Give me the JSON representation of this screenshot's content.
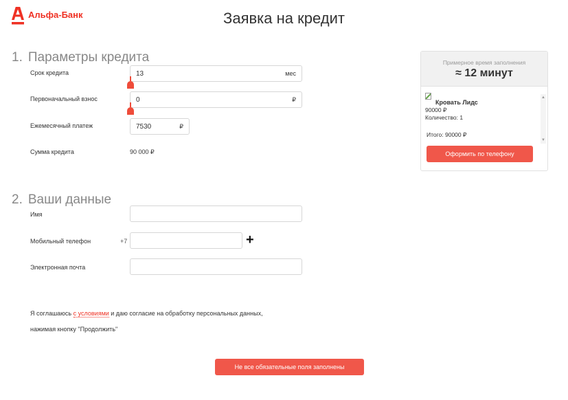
{
  "header": {
    "brand": "Альфа-Банк",
    "title": "Заявка на кредит"
  },
  "section1": {
    "number": "1.",
    "title": "Параметры кредита",
    "term": {
      "label": "Срок кредита",
      "value": "13",
      "unit": "мес"
    },
    "down_payment": {
      "label": "Первоначальный взнос",
      "value": "0",
      "unit": "₽"
    },
    "monthly": {
      "label": "Ежемесячный платеж",
      "value": "7530",
      "unit": "₽"
    },
    "sum": {
      "label": "Сумма кредита",
      "value": "90 000 ₽"
    }
  },
  "section2": {
    "number": "2.",
    "title": "Ваши данные",
    "name": {
      "label": "Имя",
      "value": ""
    },
    "phone": {
      "label": "Мобильный телефон",
      "prefix": "+7",
      "value": ""
    },
    "email": {
      "label": "Электронная почта",
      "value": ""
    }
  },
  "consent": {
    "before": "Я соглашаюсь ",
    "link": "с условиями",
    "after": " и даю согласие на обработку персональных данных,",
    "line2": "нажимая кнопку \"Продолжить\""
  },
  "submit_label": "Не все обязательные поля заполнены",
  "panel": {
    "time_label": "Примерное время заполнения",
    "time_value": "≈ 12 минут",
    "item_name": "Кровать Лидс",
    "item_price": "90000 ₽",
    "item_qty": "Количество: 1",
    "total": "Итого: 90000 ₽",
    "button": "Оформить по телефону"
  },
  "icons": {
    "logo": "alfa-logo-icon",
    "plus": "plus-icon",
    "product": "broken-image-icon"
  },
  "colors": {
    "brand": "#ef3124",
    "button": "#f0574a"
  }
}
